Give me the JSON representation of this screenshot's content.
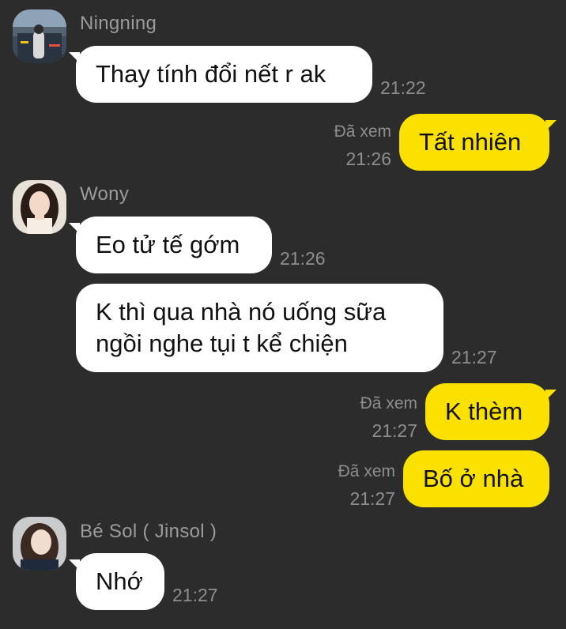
{
  "messages": [
    {
      "sender": "Ningning",
      "text": "Thay tính đổi nết r ak",
      "time": "21:22"
    },
    {
      "read": "Đã xem",
      "time": "21:26",
      "text": "Tất nhiên"
    },
    {
      "sender": "Wony",
      "text": "Eo tử tế gớm",
      "time": "21:26"
    },
    {
      "text_line1": "K thì qua nhà nó uống sữa",
      "text_line2": "ngồi nghe tụi t kể chiện",
      "time": "21:27"
    },
    {
      "read": "Đã xem",
      "time": "21:27",
      "text": "K thèm"
    },
    {
      "read": "Đã xem",
      "time": "21:27",
      "text": "Bố ở nhà"
    },
    {
      "sender": "Bé Sol ( Jinsol )",
      "text": "Nhớ",
      "time": "21:27"
    }
  ],
  "colors": {
    "background": "#2c2c2c",
    "incoming_bubble": "#ffffff",
    "outgoing_bubble": "#fae100"
  },
  "avatars": [
    "avatar-ningning",
    "avatar-wony",
    "avatar-jinsol"
  ]
}
